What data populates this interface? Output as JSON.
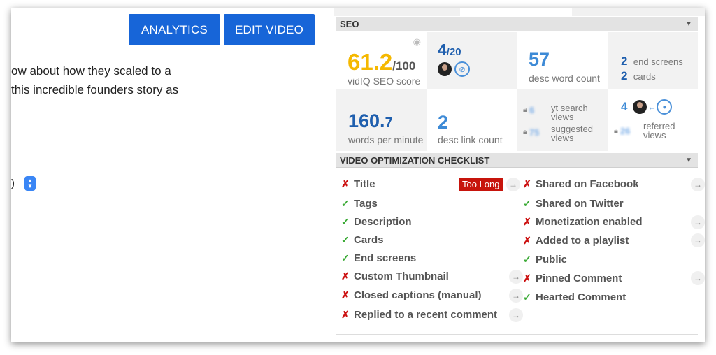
{
  "header": {
    "analytics_label": "ANALYTICS",
    "edit_video_label": "EDIT VIDEO"
  },
  "description": {
    "line1": "ow about how they scaled to a",
    "line2": " this incredible founders story as"
  },
  "select": {
    "partial_text": ")"
  },
  "seo": {
    "header": "SEO",
    "score_value": "61.2",
    "score_max": "/100",
    "score_label": "vidIQ SEO score",
    "tag_value": "4",
    "tag_max": "/20",
    "desc_word_count": "57",
    "desc_word_count_label": "desc word count",
    "end_screens_count": "2",
    "end_screens_label": "end screens",
    "cards_count": "2",
    "cards_label": "cards",
    "wpm_value": "160.",
    "wpm_decimal": "7",
    "wpm_label": "words per minute",
    "desc_link_count": "2",
    "desc_link_label": "desc link count",
    "yt_search_value": "6",
    "yt_search_label": "yt search views",
    "suggested_value": "75",
    "suggested_label": "suggested views",
    "ref_count": "4",
    "referred_value": "26",
    "referred_label": "referred views",
    "colors": {
      "score": "#f5b800",
      "primary_blue": "#1f5fae",
      "light_blue": "#3d8ad6"
    }
  },
  "checklist": {
    "header": "VIDEO OPTIMIZATION CHECKLIST",
    "too_long_badge": "Too Long",
    "left": [
      {
        "label": "Title",
        "ok": false
      },
      {
        "label": "Tags",
        "ok": true
      },
      {
        "label": "Description",
        "ok": true
      },
      {
        "label": "Cards",
        "ok": true
      },
      {
        "label": "End screens",
        "ok": true
      },
      {
        "label": "Custom Thumbnail",
        "ok": false
      },
      {
        "label": "Closed captions (manual)",
        "ok": false
      },
      {
        "label": "Replied to a recent comment",
        "ok": false
      }
    ],
    "right": [
      {
        "label": "Shared on Facebook",
        "ok": false
      },
      {
        "label": "Shared on Twitter",
        "ok": true
      },
      {
        "label": "Monetization enabled",
        "ok": false
      },
      {
        "label": "Added to a playlist",
        "ok": false
      },
      {
        "label": "Public",
        "ok": true
      },
      {
        "label": "Pinned Comment",
        "ok": false
      },
      {
        "label": "Hearted Comment",
        "ok": true
      }
    ],
    "icons": {
      "fail": "✗",
      "pass": "✓",
      "arrow": "→"
    }
  }
}
